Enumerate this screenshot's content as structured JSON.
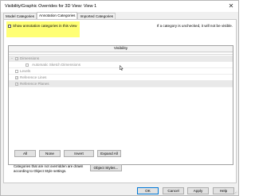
{
  "window": {
    "title": "Visibility/Graphic Overrides for 3D View: View 1",
    "close_glyph": "✕"
  },
  "tabs": [
    {
      "label": "Model Categories",
      "active": false
    },
    {
      "label": "Annotation Categories",
      "active": true
    },
    {
      "label": "Imported Categories",
      "active": false
    }
  ],
  "show_annotation": {
    "label": "Show annotation categories in this view",
    "checked": false,
    "highlight_color": "#ffff75"
  },
  "hint": "If a category is unchecked, it will not be visible.",
  "grid": {
    "column_header": "Visibility",
    "rows": [
      {
        "label": "Dimensions",
        "expander": "−",
        "checked": true,
        "indent": 0
      },
      {
        "label": "Automatic Sketch Dimensions",
        "expander": "",
        "checked": false,
        "indent": 1
      },
      {
        "label": "Levels",
        "expander": "",
        "checked": false,
        "indent": 0
      },
      {
        "label": "Reference Lines",
        "expander": "",
        "checked": true,
        "indent": 0
      },
      {
        "label": "Reference Planes",
        "expander": "",
        "checked": true,
        "indent": 0
      }
    ]
  },
  "buttons": {
    "all": "All",
    "none": "None",
    "invert": "Invert",
    "expand_all": "Expand All"
  },
  "note": {
    "line1": "Categories that are not overridden are drawn",
    "line2": "according to Object Style settings.",
    "object_styles": "Object Styles..."
  },
  "footer": {
    "ok": "OK",
    "cancel": "Cancel",
    "apply": "Apply",
    "help": "Help"
  },
  "colors": {
    "dialog_bg": "#f0f0f0",
    "checkbox_checked": "#9a9a9a",
    "disabled_text": "#8d8d8d"
  }
}
